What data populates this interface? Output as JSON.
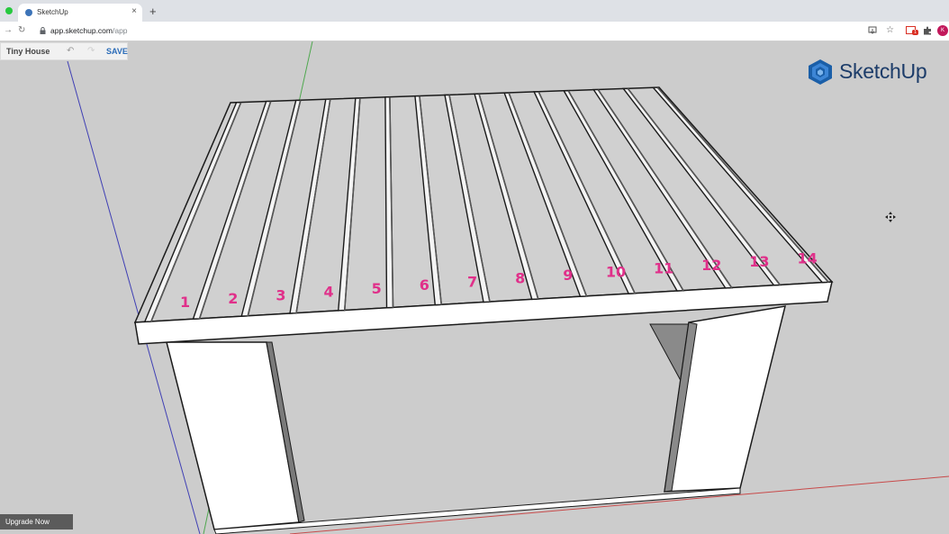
{
  "browser": {
    "tab_title": "SketchUp",
    "tab_close": "×",
    "new_tab": "+",
    "url_host": "app.sketchup.com",
    "url_path": "/app",
    "back": "→",
    "reload": "↻",
    "profile_initial": "K",
    "gmail_count": "1",
    "icons": [
      "install-icon",
      "star-icon",
      "gmail-icon",
      "extensions-icon",
      "profile-avatar"
    ]
  },
  "project": {
    "title": "Tiny House",
    "undo_icon": "↶",
    "redo_icon": "↷",
    "save_label": "SAVE"
  },
  "brand": {
    "name": "SketchUp",
    "color": "#1c3c69"
  },
  "labels": [
    "1",
    "2",
    "3",
    "4",
    "5",
    "6",
    "7",
    "8",
    "9",
    "10",
    "11",
    "12",
    "13",
    "14"
  ],
  "label_color": "#e0308a",
  "upgrade_label": "Upgrade Now",
  "colors": {
    "viewport_bg": "#cccccc",
    "axis_blue": "#3f3fb4",
    "axis_green": "#4fa84f",
    "axis_red": "#c84a4a"
  }
}
